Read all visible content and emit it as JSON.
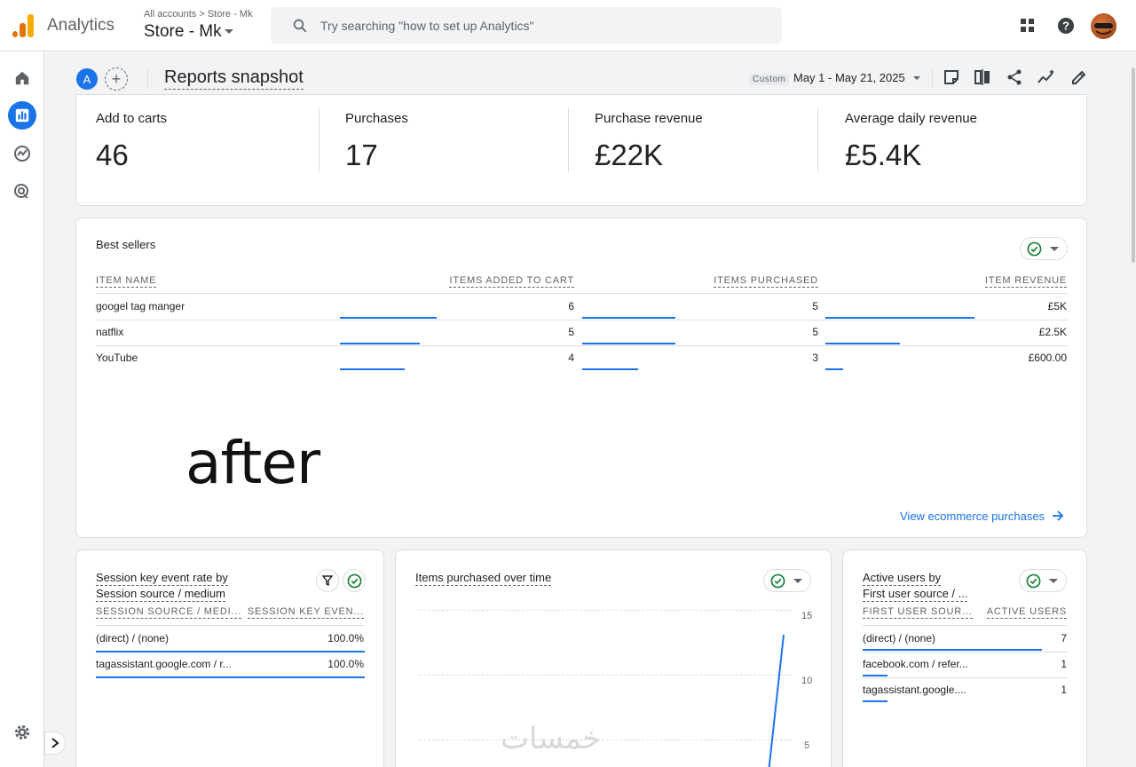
{
  "app": {
    "product_name": "Analytics",
    "account_breadcrumb": "All accounts > Store - Mk",
    "property_name": "Store - Mk"
  },
  "search": {
    "placeholder": "Try searching \"how to set up Analytics\""
  },
  "header": {
    "comparison_chip": "A",
    "add_comparison": "+",
    "title": "Reports snapshot",
    "date_badge": "Custom",
    "date_range": "May 1 - May 21, 2025"
  },
  "kpis": [
    {
      "label": "Add to carts",
      "value": "46"
    },
    {
      "label": "Purchases",
      "value": "17"
    },
    {
      "label": "Purchase revenue",
      "value": "£22K"
    },
    {
      "label": "Average daily revenue",
      "value": "£5.4K"
    }
  ],
  "best_sellers": {
    "title": "Best sellers",
    "columns": [
      "ITEM NAME",
      "ITEMS ADDED TO CART",
      "ITEMS PURCHASED",
      "ITEM REVENUE"
    ],
    "rows": [
      {
        "name": "googel tag manger",
        "added": "6",
        "purchased": "5",
        "revenue": "£5K",
        "added_frac": 1.0,
        "purchased_frac": 1.0,
        "revenue_frac": 1.0
      },
      {
        "name": "natflix",
        "added": "5",
        "purchased": "5",
        "revenue": "£2.5K",
        "added_frac": 0.83,
        "purchased_frac": 1.0,
        "revenue_frac": 0.5
      },
      {
        "name": "YouTube",
        "added": "4",
        "purchased": "3",
        "revenue": "£600.00",
        "added_frac": 0.67,
        "purchased_frac": 0.6,
        "revenue_frac": 0.12
      }
    ],
    "overlay_text": "after",
    "link": "View ecommerce purchases"
  },
  "session_card": {
    "title_line1": "Session key event rate by",
    "title_line2": "Session source / medium",
    "columns": [
      "SESSION SOURCE / MEDI...",
      "SESSION KEY EVEN..."
    ],
    "rows": [
      {
        "name": "(direct) / (none)",
        "value": "100.0%",
        "frac": 1.0
      },
      {
        "name": "tagassistant.google.com / r...",
        "value": "100.0%",
        "frac": 1.0
      }
    ]
  },
  "items_chart": {
    "title": "Items purchased  over time",
    "y_ticks": [
      "15",
      "10",
      "5"
    ]
  },
  "active_users_card": {
    "title_line1": "Active users by",
    "title_line2": "First user source / ...",
    "columns": [
      "FIRST USER SOUR...",
      "ACTIVE USERS"
    ],
    "rows": [
      {
        "name": "(direct) / (none)",
        "value": "7",
        "frac": 1.0
      },
      {
        "name": "facebook.com / refer...",
        "value": "1",
        "frac": 0.14
      },
      {
        "name": "tagassistant.google....",
        "value": "1",
        "frac": 0.14
      }
    ]
  },
  "watermark": "خمسات",
  "colors": {
    "accent": "#1a73e8",
    "success": "#188038"
  }
}
